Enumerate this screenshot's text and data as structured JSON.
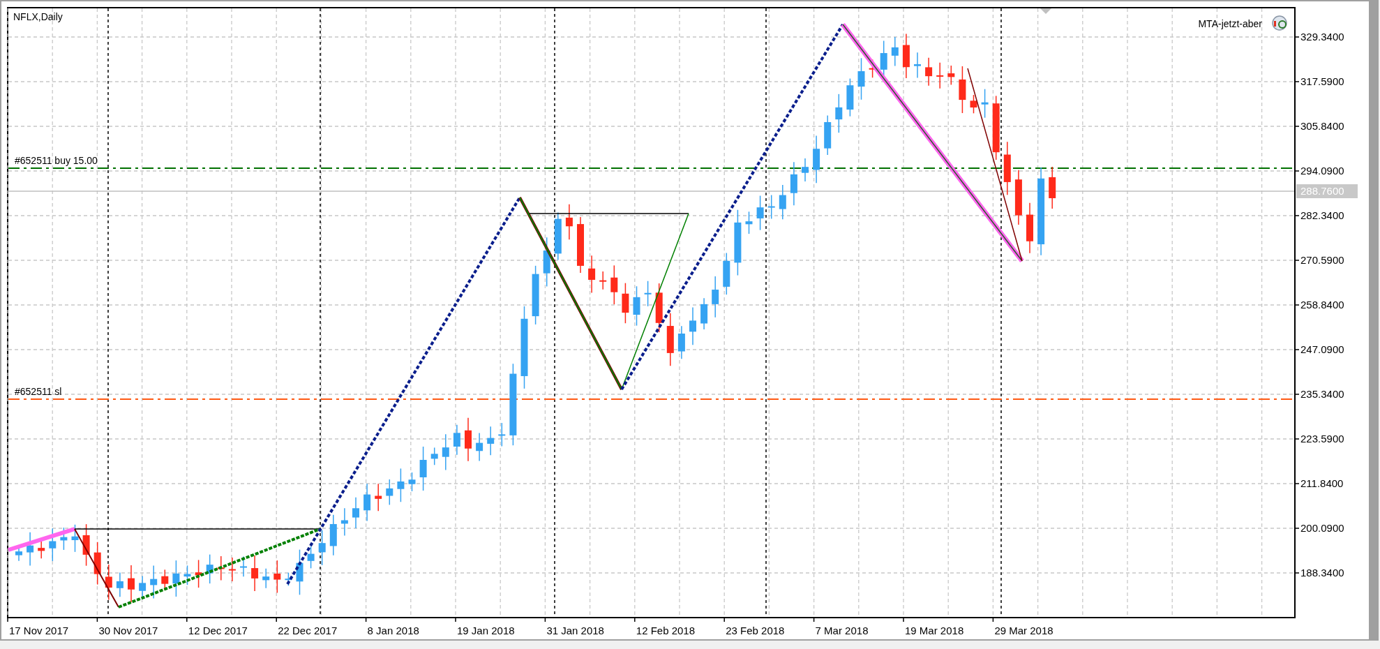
{
  "chart": {
    "title": "NFLX,Daily",
    "indicator": "MTA-jetzt-aber",
    "price_labels": [
      "329.3400",
      "317.5900",
      "305.8400",
      "294.0900",
      "282.3400",
      "270.5900",
      "258.8400",
      "247.0900",
      "235.3400",
      "223.5900",
      "211.8400",
      "200.0900",
      "188.3400"
    ],
    "current_price": "288.7600",
    "date_labels": [
      "17 Nov 2017",
      "30 Nov 2017",
      "12 Dec 2017",
      "22 Dec 2017",
      "8 Jan 2018",
      "19 Jan 2018",
      "31 Jan 2018",
      "12 Feb 2018",
      "23 Feb 2018",
      "7 Mar 2018",
      "19 Mar 2018",
      "29 Mar 2018"
    ],
    "trade_lines": [
      {
        "label": "#652511 buy 15.00",
        "kind": "order"
      },
      {
        "label": "#652511 sl",
        "kind": "stop_loss"
      }
    ]
  }
}
